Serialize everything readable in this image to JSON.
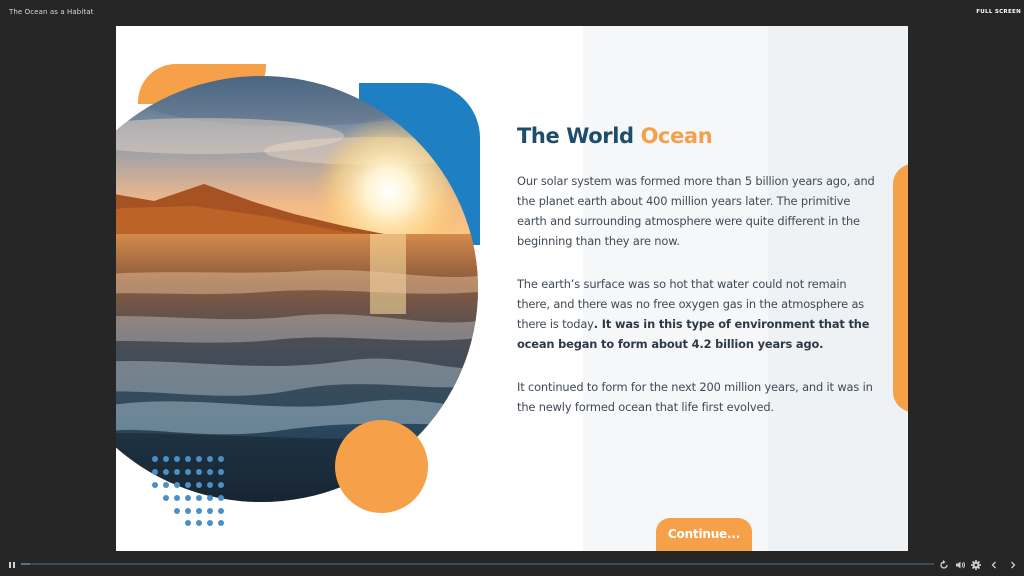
{
  "app": {
    "title": "The Ocean as a Habitat",
    "fullscreen_label": "FULL SCREEN"
  },
  "slide": {
    "title_part1": "The World",
    "title_part2": "Ocean",
    "para1": "Our solar system was formed more than 5 billion years ago, and the planet earth about 400 million years later. The primitive earth and surrounding atmosphere were quite different in the beginning than they are now.",
    "para2_normal": "The earth’s surface was so hot that water could not remain there, and there was no free oxygen gas in the atmosphere as there is today",
    "para2_bold": ". It was in this type of environment that the ocean began to form about 4.2 billion years ago.",
    "para3": "It continued to form for the next 200 million years, and it was in the newly formed ocean that life first evolved.",
    "continue_label": "Continue..."
  },
  "colors": {
    "accent_orange": "#f6a04a",
    "accent_blue": "#1e7fc3",
    "title_navy": "#1d4d6a"
  },
  "player": {
    "progress": 0.01,
    "icons": [
      "pause-icon",
      "replay-icon",
      "volume-icon",
      "settings-icon",
      "prev-icon",
      "next-icon"
    ]
  }
}
